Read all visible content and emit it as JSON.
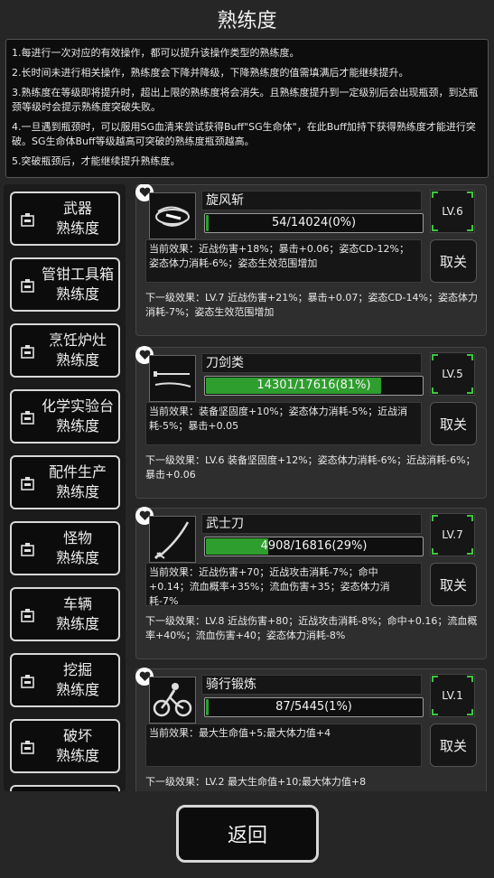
{
  "title": "熟练度",
  "info": {
    "p1": "1.每进行一次对应的有效操作，都可以提升该操作类型的熟练度。",
    "p2": "2.长时间未进行相关操作，熟练度会下降并降级，下降熟练度的值需填满后才能继续提升。",
    "p3": "3.熟练度在等级即将提升时，超出上限的熟练度将会消失。且熟练度提升到一定级别后会出现瓶颈，到达瓶颈等级时会提示熟练度突破失败。",
    "p4": "4.一旦遇到瓶颈时，可以服用SG血清来尝试获得Buff\"SG生命体\"，在此Buff加持下获得熟练度才能进行突破。SG生命体Buff等级越高可突破的熟练度瓶颈越高。",
    "p5": "5.突破瓶颈后，才能继续提升熟练度。"
  },
  "categories": [
    {
      "line1": "武器",
      "line2": "熟练度"
    },
    {
      "line1": "管钳工具箱",
      "line2": "熟练度"
    },
    {
      "line1": "烹饪炉灶",
      "line2": "熟练度"
    },
    {
      "line1": "化学实验台",
      "line2": "熟练度"
    },
    {
      "line1": "配件生产",
      "line2": "熟练度"
    },
    {
      "line1": "怪物",
      "line2": "熟练度"
    },
    {
      "line1": "车辆",
      "line2": "熟练度"
    },
    {
      "line1": "挖掘",
      "line2": "熟练度"
    },
    {
      "line1": "破坏",
      "line2": "熟练度"
    }
  ],
  "skills": [
    {
      "name": "旋风斩",
      "icon": "whirlwind-slash-icon",
      "progress": "54/14024(0%)",
      "progress_fraction": 0.0,
      "level": "LV.6",
      "current": "当前效果：近战伤害+18%；暴击+0.06；姿态CD-12%；姿态体力消耗-6%；姿态生效范围增加",
      "cancel": "取关",
      "next": "下一级效果：LV.7 近战伤害+21%；暴击+0.07；姿态CD-14%；姿态体力消耗-7%；姿态生效范围增加"
    },
    {
      "name": "刀剑类",
      "icon": "blade-icon",
      "progress": "14301/17616(81%)",
      "progress_fraction": 0.81,
      "level": "LV.5",
      "current": "当前效果：装备坚固度+10%；姿态体力消耗-5%；近战消耗-5%；暴击+0.05",
      "cancel": "取关",
      "next": "下一级效果：LV.6 装备坚固度+12%；姿态体力消耗-6%；近战消耗-6%；暴击+0.06"
    },
    {
      "name": "武士刀",
      "icon": "katana-icon",
      "progress": "4908/16816(29%)",
      "progress_fraction": 0.29,
      "level": "LV.7",
      "current": "当前效果：近战伤害+70；近战攻击消耗-7%；命中+0.14；流血概率+35%；流血伤害+35；姿态体力消耗-7%",
      "cancel": "取关",
      "next": "下一级效果：LV.8 近战伤害+80；近战攻击消耗-8%；命中+0.16；流血概率+40%；流血伤害+40；姿态体力消耗-8%"
    },
    {
      "name": "骑行锻炼",
      "icon": "cycling-icon",
      "progress": "87/5445(1%)",
      "progress_fraction": 0.01,
      "level": "LV.1",
      "current": "当前效果：最大生命值+5;最大体力值+4",
      "cancel": "取关",
      "next": "下一级效果：LV.2 最大生命值+10;最大体力值+8"
    }
  ],
  "back_label": "返回",
  "colors": {
    "accent_green": "#3ec43e",
    "bar_fill": "#2e9e2e",
    "background": "#262626"
  }
}
